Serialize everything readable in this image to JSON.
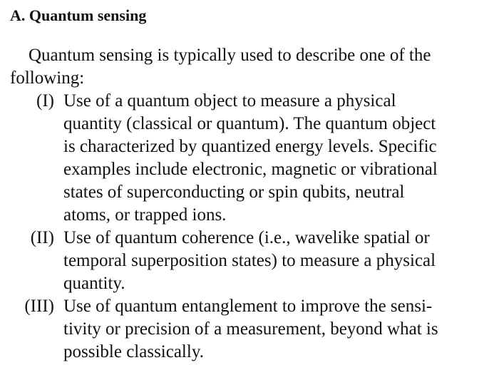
{
  "section": {
    "heading": "A. Quantum sensing"
  },
  "intro": {
    "lines": [
      "Quantum sensing is typically used to describe one of the",
      "following:"
    ]
  },
  "items": [
    {
      "marker": "(I)",
      "lines": [
        "Use of a quantum object to measure a physical",
        "quantity (classical or quantum). The quantum object",
        "is characterized by quantized energy levels. Specific",
        "examples include electronic, magnetic or vibrational",
        "states of superconducting or spin qubits, neutral",
        "atoms, or trapped ions."
      ]
    },
    {
      "marker": "(II)",
      "lines": [
        "Use of quantum coherence (i.e., wavelike spatial or",
        "temporal superposition states) to measure a physical",
        "quantity."
      ]
    },
    {
      "marker": "(III)",
      "lines": [
        "Use of quantum entanglement to improve the sensi-",
        "tivity or precision of a measurement, beyond what is",
        "possible classically."
      ]
    }
  ]
}
